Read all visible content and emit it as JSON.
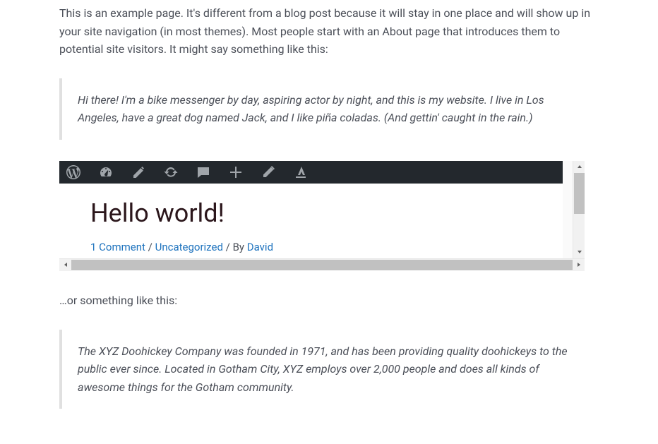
{
  "intro": "This is an example page. It's different from a blog post because it will stay in one place and will show up in your site navigation (in most themes). Most people start with an About page that introduces them to potential site visitors. It might say something like this:",
  "quote1": "Hi there! I'm a bike messenger by day, aspiring actor by night, and this is my website. I live in Los Angeles, have a great dog named Jack, and I like piña coladas. (And gettin' caught in the rain.)",
  "iframe": {
    "title": "Hello world!",
    "meta": {
      "comments": "1 Comment",
      "category": "Uncategorized",
      "by_label": "By",
      "author": "David"
    }
  },
  "bridge": "…or something like this:",
  "quote2": "The XYZ Doohickey Company was founded in 1971, and has been providing quality doohickeys to the public ever since. Located in Gotham City, XYZ employs over 2,000 people and does all kinds of awesome things for the Gotham community."
}
